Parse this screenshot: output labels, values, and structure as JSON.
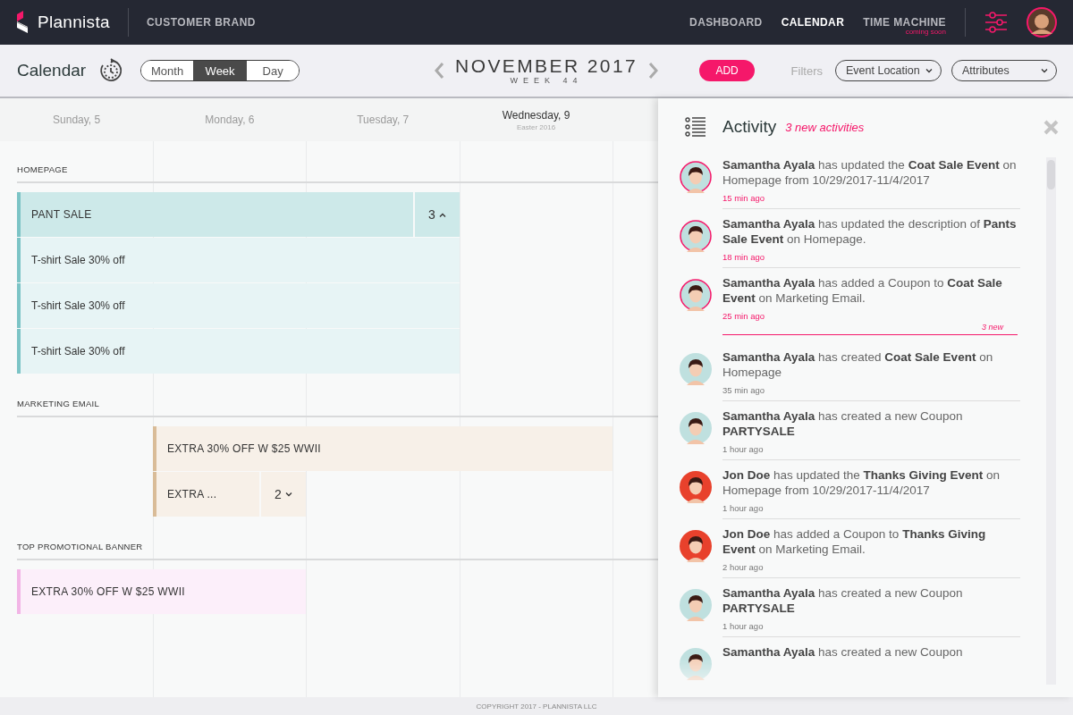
{
  "header": {
    "logo": "Plannista",
    "brand": "CUSTOMER BRAND",
    "nav": [
      {
        "label": "DASHBOARD",
        "selected": false
      },
      {
        "label": "CALENDAR",
        "selected": true
      },
      {
        "label": "TIME MACHINE",
        "selected": false,
        "note": "coming soon"
      }
    ]
  },
  "toolbar": {
    "title": "Calendar",
    "views": [
      {
        "label": "Month",
        "selected": false
      },
      {
        "label": "Week",
        "selected": true
      },
      {
        "label": "Day",
        "selected": false
      }
    ],
    "month": "NOVEMBER 2017",
    "week": "WEEK 44",
    "add": "ADD",
    "filters_label": "Filters",
    "filters": [
      {
        "label": "Event Location"
      },
      {
        "label": "Attributes"
      }
    ]
  },
  "days": [
    {
      "label": "Sunday, 5",
      "current": false
    },
    {
      "label": "Monday, 6",
      "current": false
    },
    {
      "label": "Tuesday, 7",
      "current": false
    },
    {
      "label": "Wednesday, 9",
      "current": true,
      "note": "Easter 2016"
    }
  ],
  "sections": [
    {
      "title": "HOMEPAGE",
      "color": "#7cc4c6",
      "events": [
        {
          "kind": "group",
          "title": "PANT SALE",
          "count": "3",
          "expanded": true
        },
        {
          "kind": "item",
          "title": "T-shirt Sale 30% off"
        },
        {
          "kind": "item",
          "title": "T-shirt Sale 30% off"
        },
        {
          "kind": "item",
          "title": "T-shirt Sale 30% off"
        }
      ]
    },
    {
      "title": "MARKETING EMAIL",
      "color": "#d9bc98",
      "events": [
        {
          "kind": "event",
          "title": "EXTRA 30% OFF W $25 WWII"
        },
        {
          "kind": "group",
          "title": "EXTRA ...",
          "count": "2",
          "expanded": false
        }
      ]
    },
    {
      "title": "TOP PROMOTIONAL BANNER",
      "color": "#f2b6e6",
      "events": [
        {
          "kind": "event",
          "title": "EXTRA 30% OFF W $25 WWII"
        }
      ]
    }
  ],
  "activity": {
    "title": "Activity",
    "new_count": "3 new activities",
    "new_marker": "3 new",
    "items": [
      {
        "text": "**Samantha Ayala** has updated the **Coat Sale Event** on Homepage from 10/29/2017-11/4/2017",
        "time": "15 min ago",
        "new": true,
        "color": "#bfe0df"
      },
      {
        "text": "**Samantha Ayala** has updated the description of **Pants Sale Event** on Homepage.",
        "time": "18 min ago",
        "new": true,
        "color": "#bfe0df"
      },
      {
        "text": "**Samantha Ayala** has added a Coupon to **Coat Sale Event** on Marketing Email.",
        "time": "25 min ago",
        "new": true,
        "color": "#bfe0df"
      },
      {
        "text": "**Samantha Ayala** has created **Coat Sale Event** on Homepage",
        "time": "35 min ago",
        "new": false,
        "color": "#bfe0df"
      },
      {
        "text": "**Samantha Ayala** has created a new Coupon **PARTYSALE**",
        "time": "1 hour ago",
        "new": false,
        "color": "#bfe0df"
      },
      {
        "text": "**Jon Doe** has updated the **Thanks Giving Event** on Homepage from 10/29/2017-11/4/2017",
        "time": "1 hour ago",
        "new": false,
        "color": "#e8412c"
      },
      {
        "text": "**Jon Doe** has added a Coupon to **Thanks Giving Event** on Marketing Email.",
        "time": "2 hour ago",
        "new": false,
        "color": "#e8412c"
      },
      {
        "text": "**Samantha Ayala** has created a new Coupon **PARTYSALE**",
        "time": "1 hour ago",
        "new": false,
        "color": "#bfe0df"
      },
      {
        "text": "**Samantha Ayala** has created a new Coupon",
        "new": false,
        "color": "#bfe0df"
      }
    ]
  },
  "footer": "COPYRIGHT 2017 - PLANNISTA LLC"
}
